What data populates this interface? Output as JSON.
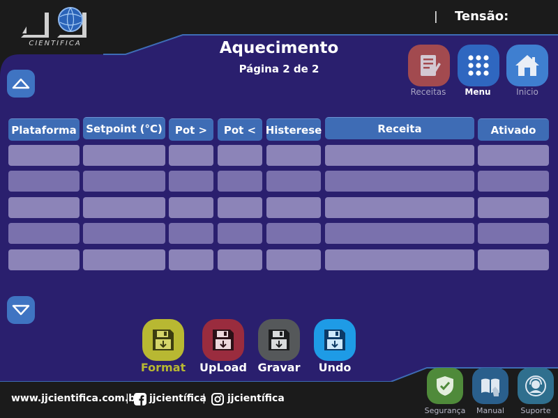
{
  "header": {
    "brand_sub": "CIENTIFICA",
    "separator": "|",
    "tension_label": "Tensão:"
  },
  "page": {
    "title": "Aquecimento",
    "subtitle": "Página 2 de 2"
  },
  "top_nav": {
    "recipes_label": "Receitas",
    "menu_label": "Menu",
    "home_label": "Inicio"
  },
  "table": {
    "headers": [
      "Plataforma",
      "Setpoint (°C)",
      "Pot >",
      "Pot <",
      "Histerese",
      "Receita",
      "Ativado"
    ],
    "rows": [
      [
        "",
        "",
        "",
        "",
        "",
        "",
        ""
      ],
      [
        "",
        "",
        "",
        "",
        "",
        "",
        ""
      ],
      [
        "",
        "",
        "",
        "",
        "",
        "",
        ""
      ],
      [
        "",
        "",
        "",
        "",
        "",
        "",
        ""
      ],
      [
        "",
        "",
        "",
        "",
        "",
        "",
        ""
      ]
    ]
  },
  "actions": {
    "format_label": "Format",
    "upload_label": "UpLoad",
    "save_label": "Gravar",
    "undo_label": "Undo"
  },
  "footer": {
    "website": "www.jjcientifica.com.br",
    "sep1": "|",
    "facebook": "jjcientífica",
    "sep2": "|",
    "instagram": "jjcientífica",
    "security_label": "Segurança",
    "manual_label": "Manual",
    "support_label": "Suporte"
  },
  "colors": {
    "panel": "#2a1f6e",
    "header_cell": "#3e6cb5",
    "row_cell": "#8c84b8",
    "accent_line": "#3e6cb5",
    "format": "#b8b832",
    "upload": "#9a2c3e",
    "save": "#55585a",
    "undo": "#1e9be6"
  },
  "icons": {
    "up": "chevron-up-icon",
    "down": "chevron-down-icon",
    "recipes": "recipe-icon",
    "menu": "grid-menu-icon",
    "home": "home-icon",
    "floppy": "floppy-icon",
    "security": "shield-check-icon",
    "manual": "manual-icon",
    "support": "support-icon",
    "facebook": "facebook-icon",
    "instagram": "instagram-icon"
  }
}
